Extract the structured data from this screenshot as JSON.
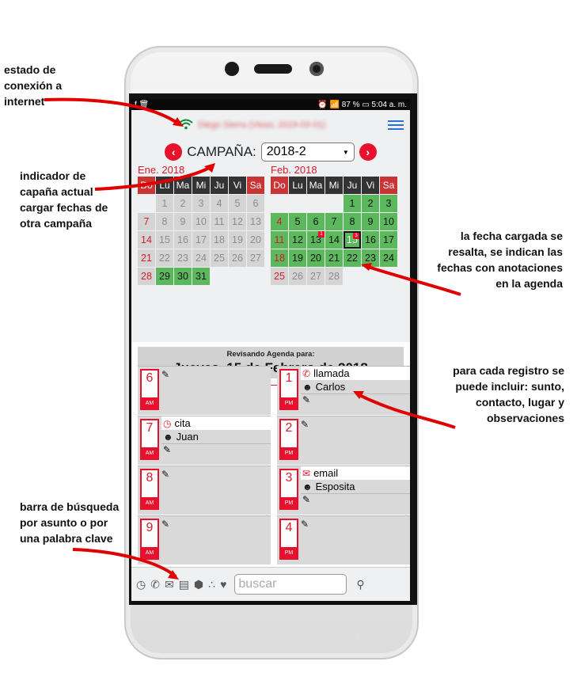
{
  "annotations": {
    "connection": [
      "estado de",
      "conexión a",
      "internet"
    ],
    "campaign": [
      "indicador de",
      "capaña actual",
      "cargar fechas de",
      "otra campaña"
    ],
    "highlight": [
      "la fecha cargada se",
      "resalta, se indican las",
      "fechas con anotaciones",
      "en la agenda"
    ],
    "record": [
      "para cada registro se",
      "puede incluir: sunto,",
      "contacto, lugar y",
      "observaciones"
    ],
    "search": [
      "barra de búsqueda",
      "por asunto o por",
      "una palabra clave"
    ]
  },
  "status_bar": {
    "left": "f 🗑",
    "right": "⏰ 📶 87 % ▭ 5:04 a. m."
  },
  "header": {
    "wifi_icon": "wifi-icon",
    "blurred_name": "Diego Sierra (Vieso, 2019-03-01)",
    "menu_icon": "hamburger-icon"
  },
  "campaign": {
    "label": "CAMPAÑA:",
    "selected": "2018-2",
    "prev": "‹",
    "next": "›"
  },
  "calendar_jan": {
    "title": "Ene. 2018",
    "days": [
      "Do",
      "Lu",
      "Ma",
      "Mi",
      "Ju",
      "Vi",
      "Sa"
    ],
    "cells": [
      "",
      "1",
      "2",
      "3",
      "4",
      "5",
      "6",
      "7",
      "8",
      "9",
      "10",
      "11",
      "12",
      "13",
      "14",
      "15",
      "16",
      "17",
      "18",
      "19",
      "20",
      "21",
      "22",
      "23",
      "24",
      "25",
      "26",
      "27",
      "28",
      "29",
      "30",
      "31"
    ]
  },
  "calendar_feb": {
    "title": "Feb. 2018",
    "days": [
      "Do",
      "Lu",
      "Ma",
      "Mi",
      "Ju",
      "Vi",
      "Sa"
    ],
    "cells": [
      "",
      "",
      "",
      "",
      "1",
      "2",
      "3",
      "4",
      "5",
      "6",
      "7",
      "8",
      "9",
      "10",
      "11",
      "12",
      "13",
      "14",
      "15",
      "16",
      "17",
      "18",
      "19",
      "20",
      "21",
      "22",
      "23",
      "24",
      "25",
      "26",
      "27",
      "28"
    ],
    "badges": {
      "13": "1",
      "15": "3"
    }
  },
  "review": {
    "subtitle": "Revisando Agenda para:",
    "date": "Jueves, 15 de Febrero de 2018"
  },
  "agenda_left": [
    {
      "hour": "6",
      "ap": "AM"
    },
    {
      "hour": "7",
      "ap": "AM",
      "subject": "cita",
      "contact": "Juan"
    },
    {
      "hour": "8",
      "ap": "AM"
    },
    {
      "hour": "9",
      "ap": "AM"
    }
  ],
  "agenda_right": [
    {
      "hour": "1",
      "ap": "PM",
      "subject": "llamada",
      "contact": "Carlos"
    },
    {
      "hour": "2",
      "ap": "PM"
    },
    {
      "hour": "3",
      "ap": "PM",
      "subject": "email",
      "contact": "Esposita"
    },
    {
      "hour": "4",
      "ap": "PM"
    }
  ],
  "bottom": {
    "search_placeholder": "buscar",
    "icons": [
      "clock-icon",
      "phone-icon",
      "mail-icon",
      "book-icon",
      "cube-icon",
      "cubes-icon",
      "heart-icon",
      "search-icon"
    ]
  },
  "colors": {
    "accent": "#e8112d",
    "green": "#5cb85c",
    "gray": "#d4d4d4"
  }
}
